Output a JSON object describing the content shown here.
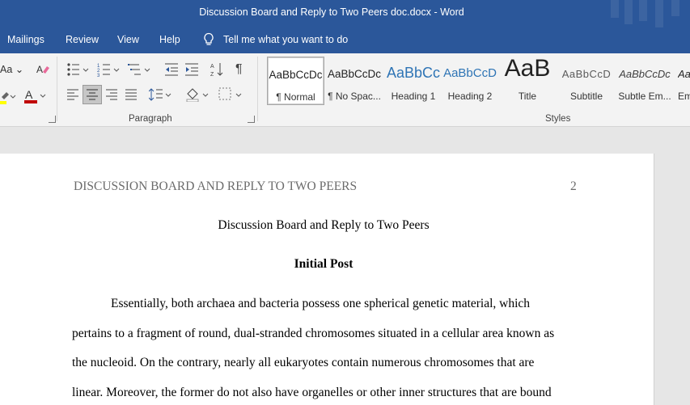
{
  "window": {
    "title": "Discussion Board and Reply to Two Peers doc.docx  -  Word"
  },
  "tabs": [
    {
      "label": "Mailings"
    },
    {
      "label": "Review"
    },
    {
      "label": "View"
    },
    {
      "label": "Help"
    }
  ],
  "tell_me": {
    "label": "Tell me what you want to do"
  },
  "font_group": {
    "font_size_label": "Aa",
    "font_color": "#c00000",
    "highlight_color": "#ffff00"
  },
  "paragraph_group": {
    "label": "Paragraph"
  },
  "styles_group": {
    "label": "Styles",
    "items": [
      {
        "sample": "AaBbCcDc",
        "name": "¶ Normal",
        "selected": true
      },
      {
        "sample": "AaBbCcDc",
        "name": "¶ No Spac..."
      },
      {
        "sample": "AaBbCc",
        "name": "Heading 1"
      },
      {
        "sample": "AaBbCcD",
        "name": "Heading 2"
      },
      {
        "sample": "AaB",
        "name": "Title"
      },
      {
        "sample": "AaBbCcD",
        "name": "Subtitle"
      },
      {
        "sample": "AaBbCcDc",
        "name": "Subtle Em..."
      },
      {
        "sample": "Aa",
        "name": "Em"
      }
    ]
  },
  "document": {
    "running_head": "DISCUSSION BOARD AND REPLY TO TWO PEERS",
    "page_number": "2",
    "title": "Discussion Board and Reply to Two Peers",
    "section_heading": "Initial Post",
    "lines": [
      "Essentially, both archaea and bacteria possess one spherical genetic material, which",
      "pertains to a fragment of round, dual-stranded chromosomes situated in a cellular area known as",
      "the nucleoid. On the contrary, nearly all eukaryotes contain numerous chromosomes that are",
      "linear. Moreover, the former do not also have organelles or other inner structures that are bound"
    ]
  }
}
